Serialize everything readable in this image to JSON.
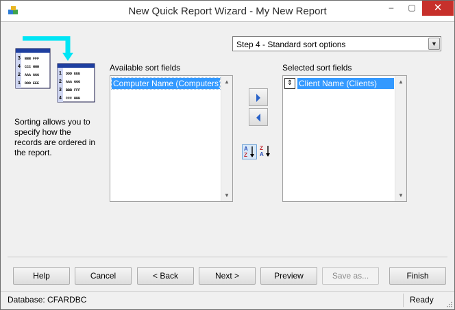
{
  "window": {
    "title": "New Quick Report Wizard - My New Report",
    "controls": {
      "minimize": "–",
      "maximize": "▢",
      "close": "✕"
    }
  },
  "step_selector": {
    "value": "Step 4 - Standard sort options",
    "arrow": "▼"
  },
  "illustration": {
    "icon": "sort-records-illustration-icon",
    "back_sheet_rows": [
      {
        "num": "3",
        "text": "BBB FFF"
      },
      {
        "num": "4",
        "text": "CCC HHH"
      },
      {
        "num": "2",
        "text": "AAA GGG"
      },
      {
        "num": "1",
        "text": "DDD EEE"
      }
    ],
    "front_sheet_rows": [
      {
        "num": "1",
        "text": "DDD EEE"
      },
      {
        "num": "2",
        "text": "AAA GGG"
      },
      {
        "num": "3",
        "text": "BBB FFF"
      },
      {
        "num": "4",
        "text": "CCC HHH"
      }
    ]
  },
  "hint_text": "Sorting allows you to specify how the records are ordered in the report.",
  "available": {
    "label": "Available sort fields",
    "items": [
      "Computer Name (Computers)"
    ]
  },
  "selected": {
    "label": "Selected sort fields",
    "items": [
      {
        "label": "Client Name (Clients)",
        "handle": "⇕"
      }
    ]
  },
  "move_buttons": {
    "add_icon": "arrow-right-icon",
    "remove_icon": "arrow-left-icon"
  },
  "sort_direction": {
    "ascending": {
      "top": "A",
      "bottom": "Z"
    },
    "descending": {
      "top": "Z",
      "bottom": "A"
    }
  },
  "buttons": {
    "help": "Help",
    "cancel": "Cancel",
    "back": "< Back",
    "next": "Next >",
    "preview": "Preview",
    "save_as": "Save as...",
    "finish": "Finish"
  },
  "status": {
    "database": "Database: CFARDBC",
    "state": "Ready"
  },
  "scroll": {
    "up": "▲",
    "down": "▼"
  },
  "colors": {
    "selection": "#3399ff",
    "close_button": "#c7302b",
    "illustration_cyan": "#00e5f5"
  }
}
